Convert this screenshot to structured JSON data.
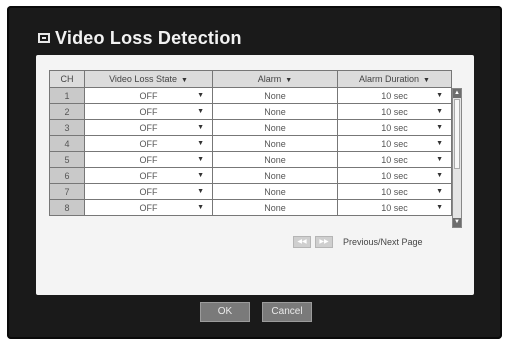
{
  "window": {
    "title": "Video Loss Detection"
  },
  "table": {
    "headers": {
      "ch": "CH",
      "state": "Video Loss State",
      "alarm": "Alarm",
      "duration": "Alarm Duration"
    },
    "rows": [
      {
        "ch": "1",
        "state": "OFF",
        "alarm": "None",
        "duration": "10 sec"
      },
      {
        "ch": "2",
        "state": "OFF",
        "alarm": "None",
        "duration": "10 sec"
      },
      {
        "ch": "3",
        "state": "OFF",
        "alarm": "None",
        "duration": "10 sec"
      },
      {
        "ch": "4",
        "state": "OFF",
        "alarm": "None",
        "duration": "10 sec"
      },
      {
        "ch": "5",
        "state": "OFF",
        "alarm": "None",
        "duration": "10 sec"
      },
      {
        "ch": "6",
        "state": "OFF",
        "alarm": "None",
        "duration": "10 sec"
      },
      {
        "ch": "7",
        "state": "OFF",
        "alarm": "None",
        "duration": "10 sec"
      },
      {
        "ch": "8",
        "state": "OFF",
        "alarm": "None",
        "duration": "10 sec"
      }
    ]
  },
  "pager": {
    "label": "Previous/Next Page"
  },
  "buttons": {
    "ok": "OK",
    "cancel": "Cancel"
  },
  "icons": {
    "title": "monitor-icon",
    "dropdown": "chevron-down-icon",
    "prev": "arrow-left-icon",
    "next": "arrow-right-icon"
  },
  "colors": {
    "frame": "#1a1a1a",
    "panel": "#f4f4f4",
    "header_bg": "#dcdcdc",
    "ch_bg": "#c9c9c9",
    "button": "#7a7a7a"
  }
}
